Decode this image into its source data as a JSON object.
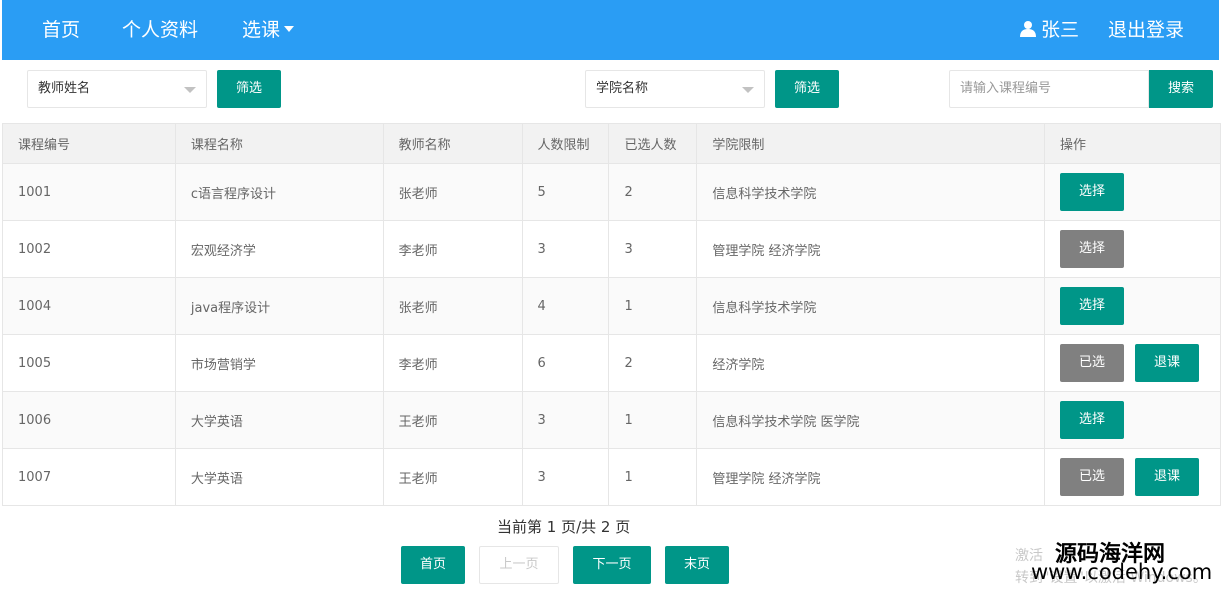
{
  "nav": {
    "home": "首页",
    "profile": "个人资料",
    "course_select": "选课",
    "user_name": "张三",
    "logout": "退出登录"
  },
  "filters": {
    "teacher_select": "教师姓名",
    "teacher_filter_btn": "筛选",
    "college_select": "学院名称",
    "college_filter_btn": "筛选",
    "search_placeholder": "请输入课程编号",
    "search_btn": "搜索"
  },
  "table": {
    "headers": [
      "课程编号",
      "课程名称",
      "教师名称",
      "人数限制",
      "已选人数",
      "学院限制",
      "操作"
    ],
    "rows": [
      {
        "id": "1001",
        "name": "c语言程序设计",
        "teacher": "张老师",
        "limit": "5",
        "selected": "2",
        "college": "信息科学技术学院",
        "action": "选择",
        "action_state": "enabled",
        "drop": ""
      },
      {
        "id": "1002",
        "name": "宏观经济学",
        "teacher": "李老师",
        "limit": "3",
        "selected": "3",
        "college": "管理学院  经济学院",
        "action": "选择",
        "action_state": "disabled",
        "drop": ""
      },
      {
        "id": "1004",
        "name": "java程序设计",
        "teacher": "张老师",
        "limit": "4",
        "selected": "1",
        "college": "信息科学技术学院",
        "action": "选择",
        "action_state": "enabled",
        "drop": ""
      },
      {
        "id": "1005",
        "name": "市场营销学",
        "teacher": "李老师",
        "limit": "6",
        "selected": "2",
        "college": "经济学院",
        "action": "已选",
        "action_state": "disabled",
        "drop": "退课"
      },
      {
        "id": "1006",
        "name": "大学英语",
        "teacher": "王老师",
        "limit": "3",
        "selected": "1",
        "college": "信息科学技术学院  医学院",
        "action": "选择",
        "action_state": "enabled",
        "drop": ""
      },
      {
        "id": "1007",
        "name": "大学英语",
        "teacher": "王老师",
        "limit": "3",
        "selected": "1",
        "college": "管理学院  经济学院",
        "action": "已选",
        "action_state": "disabled",
        "drop": "退课"
      }
    ]
  },
  "pagination": {
    "info": "当前第 1 页/共 2 页",
    "first": "首页",
    "prev": "上一页",
    "next": "下一页",
    "last": "末页"
  },
  "watermark": {
    "activate_line1": "激活",
    "activate_line2": "转到\"设置\"以激活 Windows。",
    "site_name": "源码海洋网",
    "site_url": "www.codehy.com"
  },
  "colors": {
    "navbar": "#2a9df4",
    "primary_button": "#009688",
    "disabled_button": "#808080"
  }
}
